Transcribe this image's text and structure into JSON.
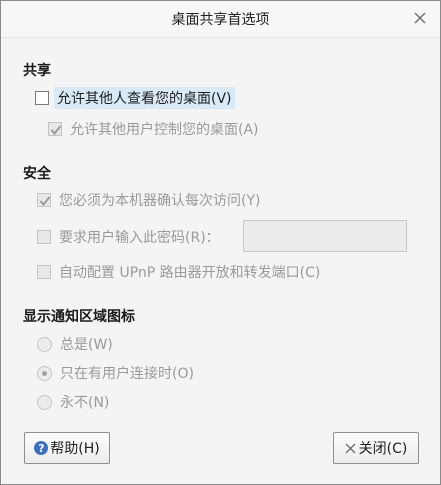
{
  "window": {
    "title": "桌面共享首选项"
  },
  "sharing": {
    "title": "共享",
    "allow_view": {
      "label": "允许其他人查看您的桌面(V)",
      "checked": false
    },
    "allow_control": {
      "label": "允许其他用户控制您的桌面(A)",
      "checked": true,
      "enabled": false
    }
  },
  "security": {
    "title": "安全",
    "confirm_access": {
      "label": "您必须为本机器确认每次访问(Y)",
      "checked": true,
      "enabled": false
    },
    "require_password": {
      "label": "要求用户输入此密码(R)：",
      "checked": false,
      "enabled": false
    },
    "password_value": "",
    "upnp": {
      "label": "自动配置 UPnP 路由器开放和转发端口(C)",
      "checked": false,
      "enabled": false
    }
  },
  "notification": {
    "title": "显示通知区域图标",
    "options": [
      {
        "label": "总是(W)",
        "selected": false
      },
      {
        "label": "只在有用户连接时(O)",
        "selected": true
      },
      {
        "label": "永不(N)",
        "selected": false
      }
    ]
  },
  "buttons": {
    "help_label": "帮助(H)",
    "close_label": "关闭(C)"
  },
  "icons": {
    "close": "close-icon",
    "help": "help-icon",
    "checkmark": "checkmark-icon"
  }
}
